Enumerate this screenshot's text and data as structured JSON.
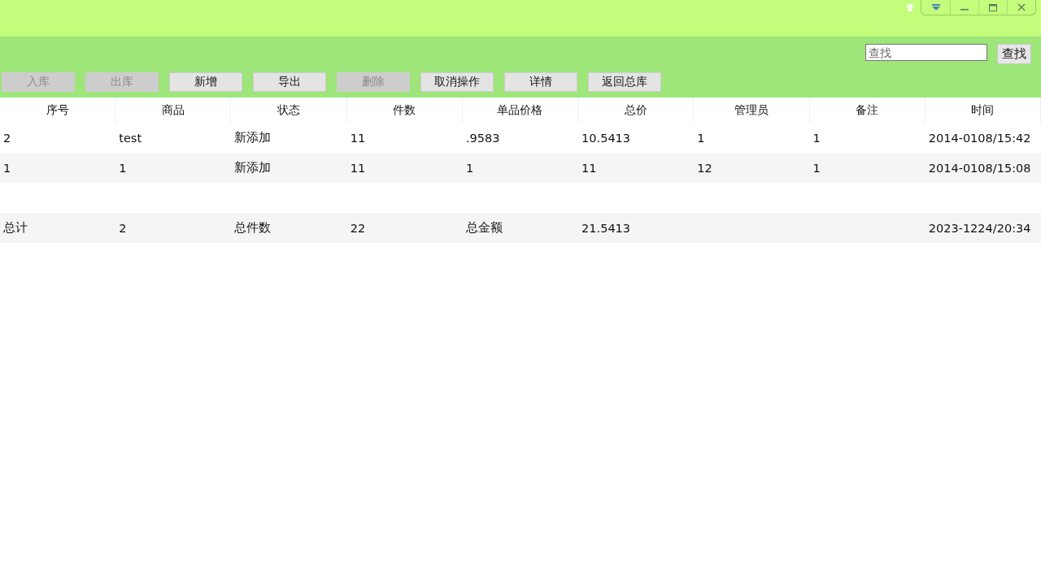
{
  "search": {
    "placeholder": "查找",
    "button": "查找"
  },
  "toolbar": [
    {
      "label": "入库",
      "disabled": true
    },
    {
      "label": "出库",
      "disabled": true
    },
    {
      "label": "新增",
      "disabled": false
    },
    {
      "label": "导出",
      "disabled": false
    },
    {
      "label": "删除",
      "disabled": true
    },
    {
      "label": "取消操作",
      "disabled": false
    },
    {
      "label": "详情",
      "disabled": false
    },
    {
      "label": "返回总库",
      "disabled": false
    }
  ],
  "table": {
    "columns": [
      "序号",
      "商品",
      "状态",
      "件数",
      "单品价格",
      "总价",
      "管理员",
      "备注",
      "时间"
    ],
    "rows": [
      {
        "cells": [
          "2",
          "test",
          "新添加",
          "11",
          ".9583",
          "10.5413",
          "1",
          "1",
          "2014-0108/15:42"
        ]
      },
      {
        "cells": [
          "1",
          "1",
          "新添加",
          "11",
          "1",
          "11",
          "12",
          "1",
          "2014-0108/15:08"
        ]
      }
    ],
    "totals": {
      "label": "总计",
      "count": "2",
      "qty_label": "总件数",
      "qty": "22",
      "amount_label": "总金额",
      "amount": "21.5413",
      "time": "2023-1224/20:34"
    }
  }
}
